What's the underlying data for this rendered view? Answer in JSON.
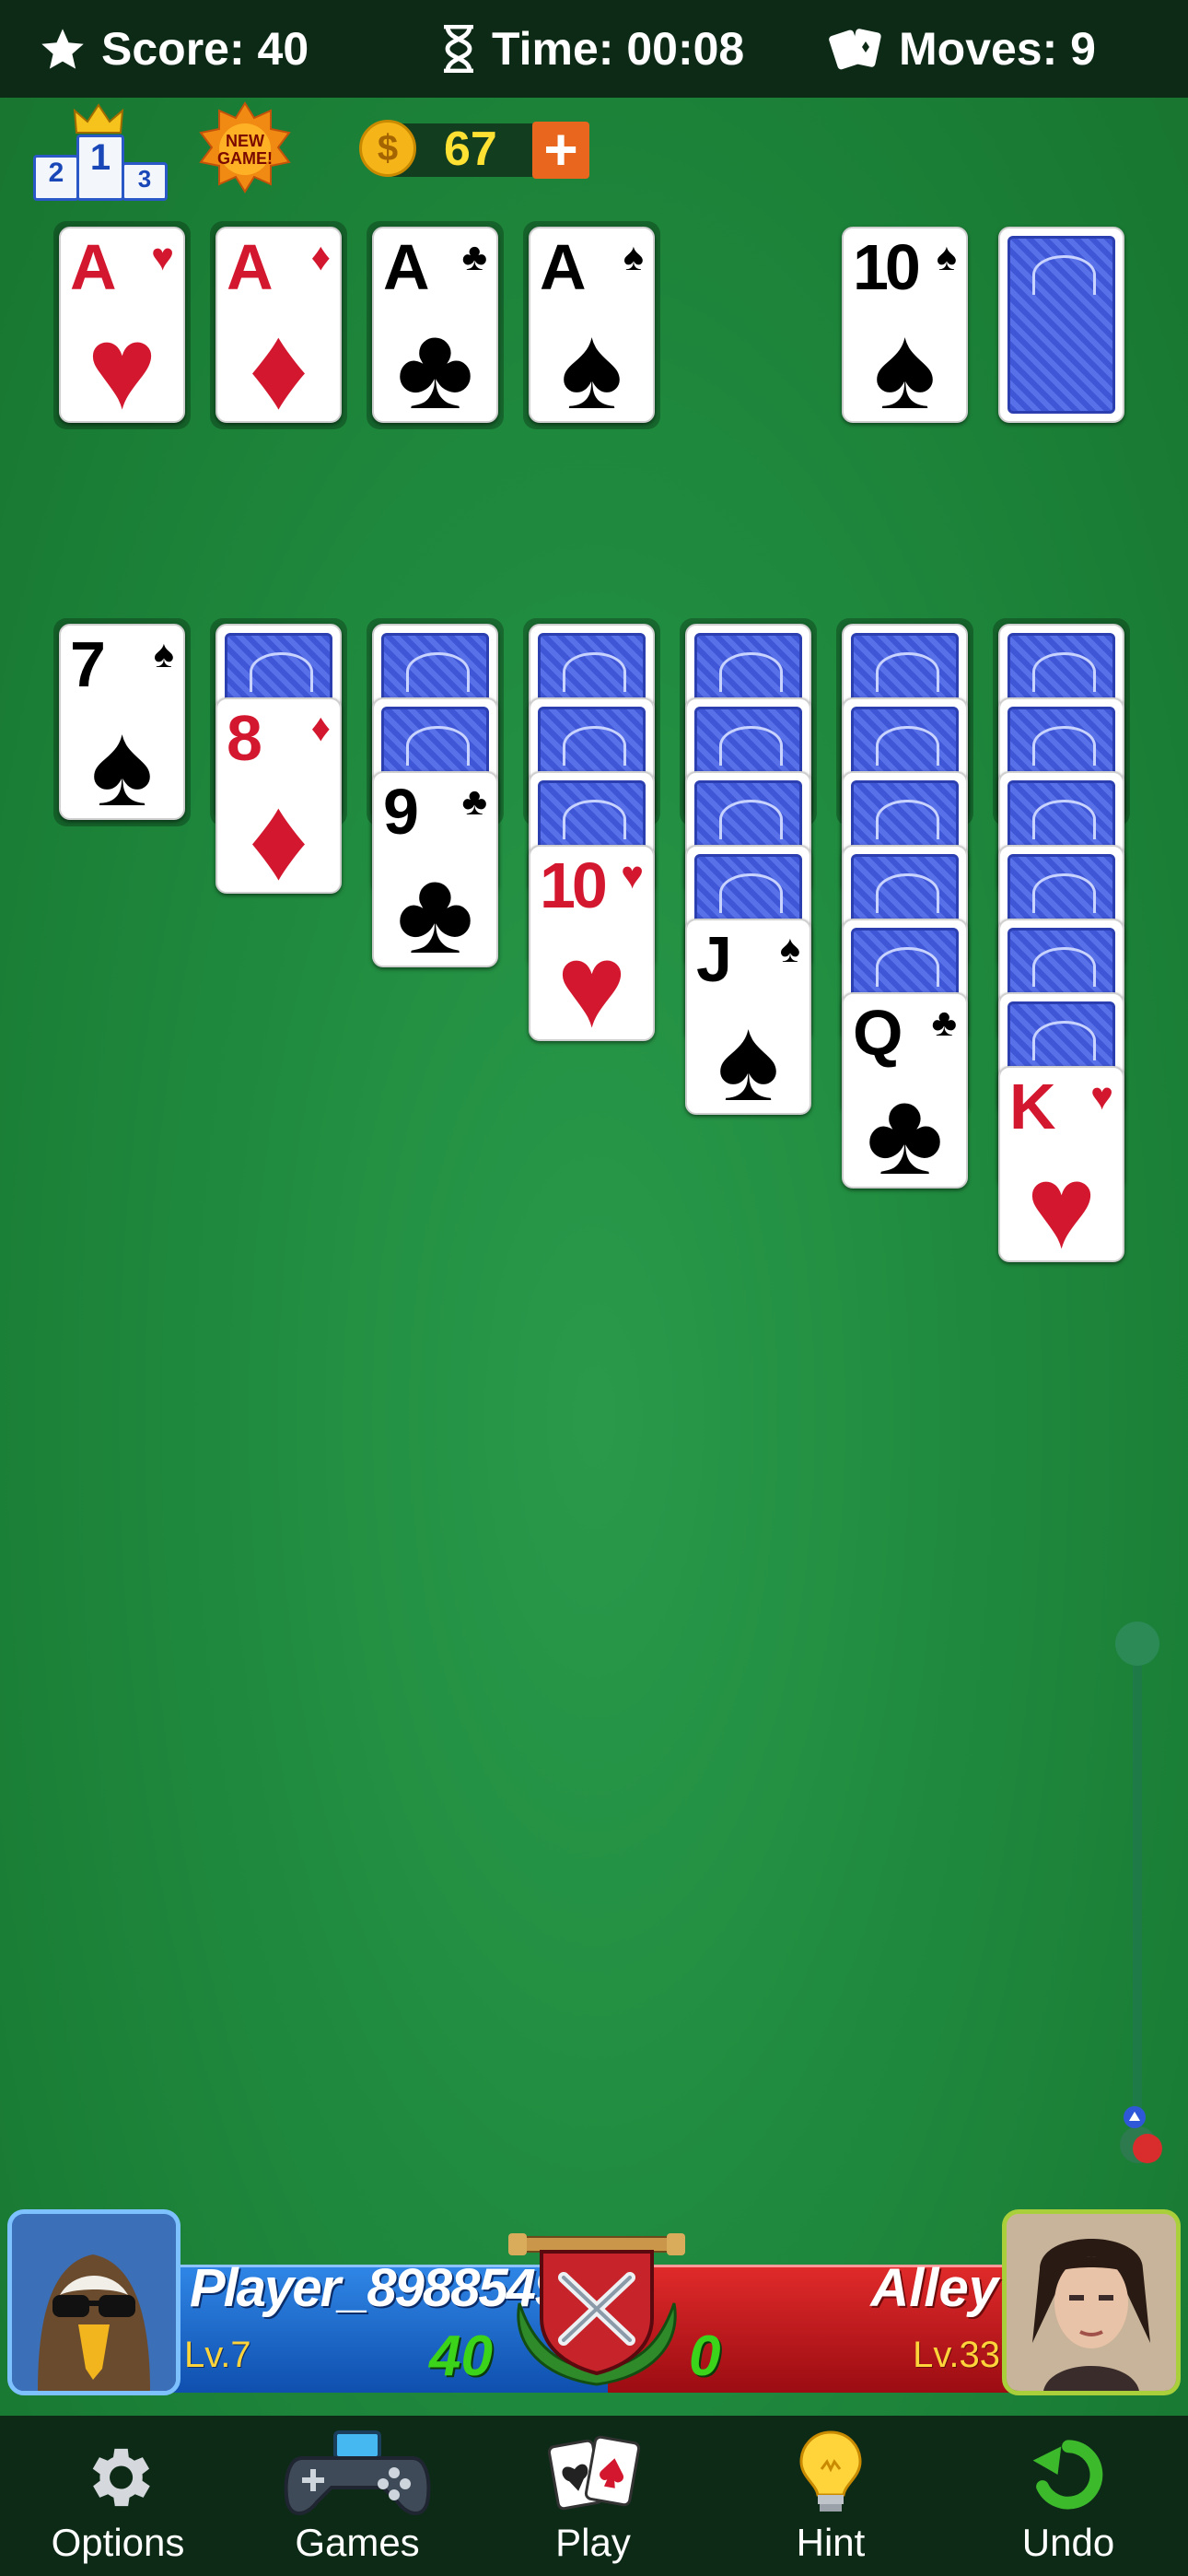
{
  "header": {
    "score_label": "Score: 40",
    "time_label": "Time: 00:08",
    "moves_label": "Moves: 9"
  },
  "toolbar": {
    "leaderboard_digits": [
      "2",
      "1",
      "3"
    ],
    "new_game_badge": "NEW GAME!",
    "coins": "67",
    "coin_symbol": "$",
    "add_coins": "+"
  },
  "foundations": [
    {
      "rank": "A",
      "suit": "♥",
      "color": "red"
    },
    {
      "rank": "A",
      "suit": "♦",
      "color": "red"
    },
    {
      "rank": "A",
      "suit": "♣",
      "color": "black"
    },
    {
      "rank": "A",
      "suit": "♠",
      "color": "black"
    }
  ],
  "waste": {
    "rank": "10",
    "suit": "♠",
    "color": "black"
  },
  "tableau": [
    {
      "face_down": 0,
      "card": {
        "rank": "7",
        "suit": "♠",
        "color": "black"
      }
    },
    {
      "face_down": 1,
      "card": {
        "rank": "8",
        "suit": "♦",
        "color": "red"
      }
    },
    {
      "face_down": 2,
      "card": {
        "rank": "9",
        "suit": "♣",
        "color": "black"
      }
    },
    {
      "face_down": 3,
      "card": {
        "rank": "10",
        "suit": "♥",
        "color": "red"
      }
    },
    {
      "face_down": 4,
      "card": {
        "rank": "J",
        "suit": "♠",
        "color": "black"
      }
    },
    {
      "face_down": 5,
      "card": {
        "rank": "Q",
        "suit": "♣",
        "color": "black"
      }
    },
    {
      "face_down": 6,
      "card": {
        "rank": "K",
        "suit": "♥",
        "color": "red"
      }
    }
  ],
  "versus": {
    "player_name": "Player_8988549",
    "player_level": "Lv.7",
    "player_score": "40",
    "opponent_name": "Alley",
    "opponent_level": "Lv.33",
    "opponent_score": "0"
  },
  "nav": [
    {
      "label": "Options",
      "icon": "gear-icon"
    },
    {
      "label": "Games",
      "icon": "gamepad-icon"
    },
    {
      "label": "Play",
      "icon": "cards-icon"
    },
    {
      "label": "Hint",
      "icon": "lightbulb-icon"
    },
    {
      "label": "Undo",
      "icon": "undo-icon"
    }
  ],
  "colors": {
    "felt": "#1f8a3e",
    "bar": "#0d2a17",
    "card_red": "#d3172f",
    "card_back": "#3f57d6",
    "player_blue": "#1a6fd0",
    "opponent_red": "#c8161d",
    "score_green": "#3bd41a",
    "level_yellow": "#ffd43b"
  }
}
